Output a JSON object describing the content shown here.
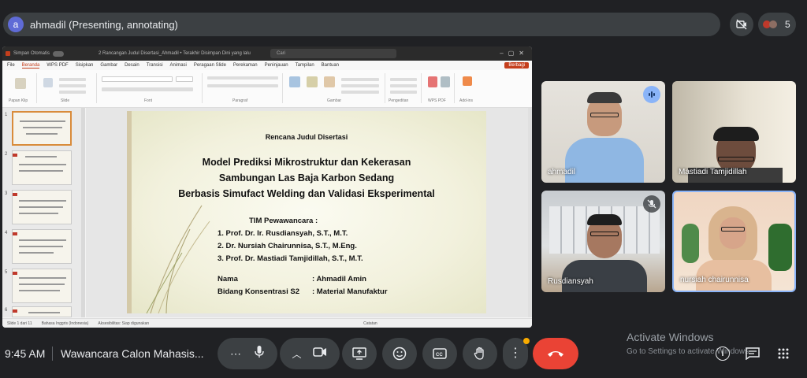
{
  "presenter": {
    "initial": "a",
    "label": "ahmadil (Presenting, annotating)"
  },
  "participants_count": "5",
  "ppt": {
    "autosave": "Simpan Otomatis",
    "doc_title": "2 Rancangan Judul Disertasi_Ahmadil • Terakhir Disimpan Dini yang lalu",
    "search_placeholder": "Cari",
    "tabs": [
      "File",
      "Beranda",
      "WPS PDF",
      "Sisipkan",
      "Gambar",
      "Desain",
      "Transisi",
      "Animasi",
      "Peragaan Slide",
      "Perekaman",
      "Peninjauan",
      "Tampilan",
      "Bantuan"
    ],
    "active_tab": "Beranda",
    "share": "Berbagi",
    "ribbon_groups": [
      "Papan Klip",
      "Slide",
      "Font",
      "Paragraf",
      "Gambar",
      "Pengeditan",
      "WPS PDF",
      "Add-ins"
    ],
    "thumb_numbers": [
      "1",
      "2",
      "3",
      "4",
      "5",
      "6"
    ],
    "status_left": "Slide 1 dari 11",
    "status_lang": "Bahasa Inggris (Indonesia)",
    "status_access": "Aksesibilitas: Siap digunakan",
    "status_notes": "Catatan"
  },
  "slide": {
    "subtitle": "Rencana Judul Disertasi",
    "title_lines": [
      "Model Prediksi Mikrostruktur dan Kekerasan",
      "Sambungan Las Baja Karbon Sedang",
      "Berbasis Simufact Welding dan Validasi Eksperimental"
    ],
    "panel_heading": "TIM Pewawancara :",
    "panel": [
      "1. Prof. Dr. Ir. Rusdiansyah, S.T., M.T.",
      "2. Dr. Nursiah Chairunnisa, S.T., M.Eng.",
      "3. Prof. Dr. Mastiadi Tamjidillah, S.T., M.T."
    ],
    "fields": [
      {
        "key": "Nama",
        "value": ": Ahmadil Amin"
      },
      {
        "key": "Bidang Konsentrasi S2",
        "value": ": Material Manufaktur"
      }
    ]
  },
  "tiles": [
    {
      "name": "ahmadil",
      "badge": "speaking-icon"
    },
    {
      "name": "Mastiadi Tamjidillah",
      "badge": ""
    },
    {
      "name": "Rusdiansyah",
      "badge": "mic-off-icon"
    },
    {
      "name": "nursiah chairunnisa",
      "badge": ""
    }
  ],
  "bottom": {
    "time": "9:45 AM",
    "meeting_title": "Wawancara Calon Mahasis...",
    "activate_title": "Activate Windows",
    "activate_sub": "Go to Settings to activate Windows."
  },
  "colors": {
    "end_call": "#ea4335",
    "bar_bg": "#3c4043",
    "accent_orange": "#c43e1c"
  }
}
